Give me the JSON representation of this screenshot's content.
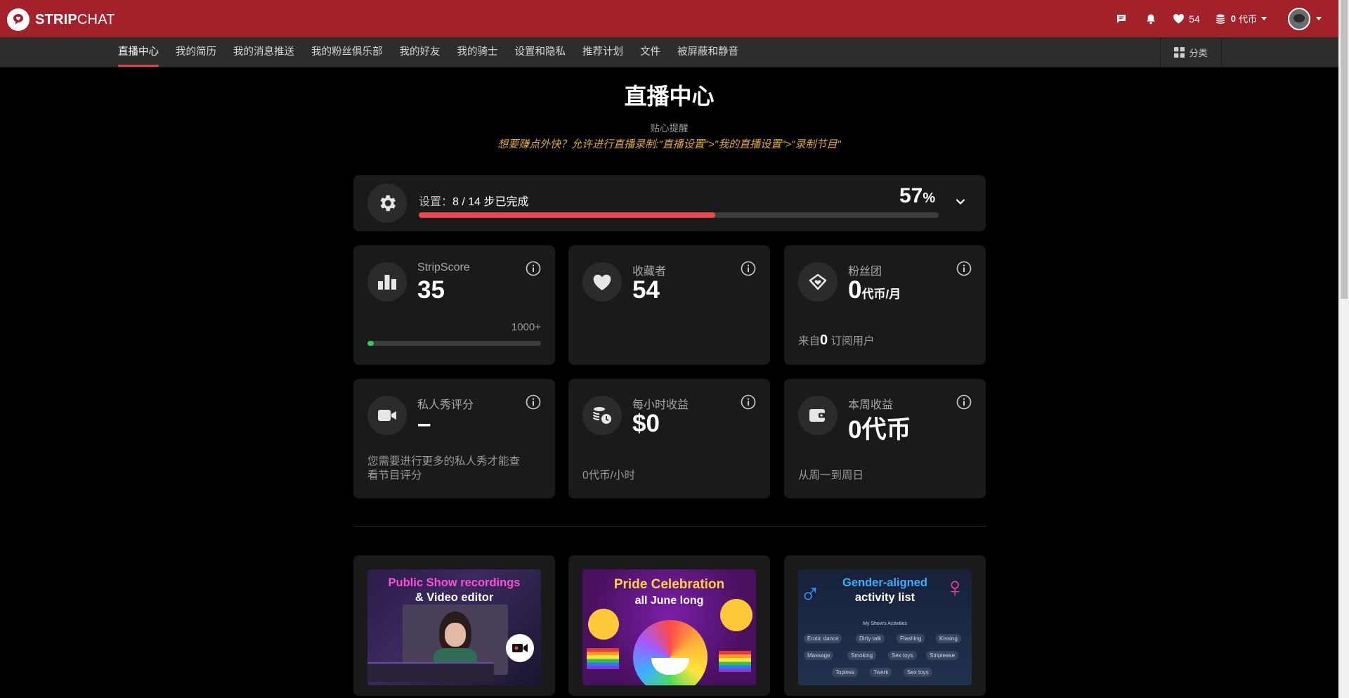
{
  "brand": {
    "name_bold": "STRIP",
    "name_rest": "CHAT"
  },
  "topbar": {
    "favorites_count": "54",
    "tokens_amount": "0",
    "tokens_label": "代币"
  },
  "nav": {
    "items": [
      {
        "label": "直播中心",
        "active": true
      },
      {
        "label": "我的简历"
      },
      {
        "label": "我的消息推送"
      },
      {
        "label": "我的粉丝俱乐部"
      },
      {
        "label": "我的好友"
      },
      {
        "label": "我的骑士"
      },
      {
        "label": "设置和隐私"
      },
      {
        "label": "推荐计划"
      },
      {
        "label": "文件"
      },
      {
        "label": "被屏蔽和静音"
      }
    ],
    "categories_label": "分类"
  },
  "page": {
    "title": "直播中心",
    "tip_label": "贴心提醒",
    "tip_text": "想要赚点外快？允许进行直播录制:\"直播设置\">\"我的直播设置\">\"录制节目\""
  },
  "setup": {
    "prefix": "设置：",
    "progress_text": "8 / 14",
    "suffix": " 步已完成",
    "percent_value": "57",
    "percent_sign": "%",
    "progress_fraction": 0.57
  },
  "stats": {
    "stripscore": {
      "label": "StripScore",
      "value": "35",
      "max_label": "1000+",
      "progress_fraction": 0.035
    },
    "favorites": {
      "label": "收藏者",
      "value": "54"
    },
    "fanclub": {
      "label": "粉丝团",
      "value": "0",
      "unit": "代币/月",
      "foot_prefix": "来自",
      "foot_count": "0",
      "foot_suffix": " 订阅用户"
    },
    "private_rating": {
      "label": "私人秀评分",
      "value": "–",
      "foot": "您需要进行更多的私人秀才能查看节目评分"
    },
    "hourly": {
      "label": "每小时收益",
      "value": "$0",
      "foot": "0代币/小时"
    },
    "weekly": {
      "label": "本周收益",
      "value": "0代币",
      "foot": "从周一到周日"
    }
  },
  "promos": [
    {
      "line1": "Public Show recordings",
      "line2": "& Video editor"
    },
    {
      "line1": "Pride Celebration",
      "line2": "all June long"
    },
    {
      "line1": "Gender-aligned",
      "line2": "activity list",
      "panel_title": "My Show's Activities",
      "chips": [
        "Erotic dance",
        "Dirty talk",
        "Flashing",
        "Kissing",
        "Massage",
        "Smoking",
        "Sex toys",
        "Striptease",
        "Topless",
        "Twerk",
        "Sex toys"
      ]
    }
  ],
  "colors": {
    "topbar": "#a2212b",
    "accent": "#e8474e",
    "tip": "#e0a93a",
    "score_green": "#2ecc55"
  }
}
